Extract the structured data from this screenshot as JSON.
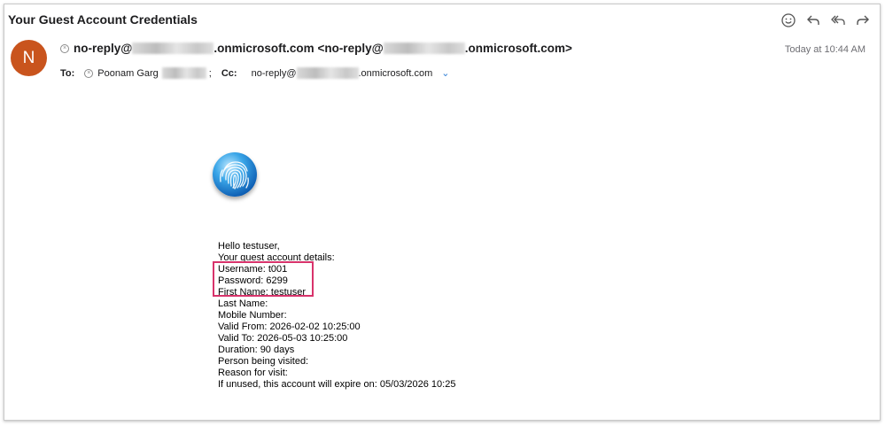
{
  "email": {
    "subject": "Your Guest Account Credentials",
    "avatar_initial": "N",
    "avatar_color": "#c9541d",
    "from_prefix": "no-reply@",
    "from_domain": ".onmicrosoft.com",
    "from_open": " <no-reply@",
    "from_close": ".onmicrosoft.com>",
    "date": "Today at 10:44 AM",
    "to_label": "To:",
    "to_name": "Poonam Garg",
    "to_sep": ";",
    "cc_label": "Cc:",
    "cc_prefix": "no-reply@",
    "cc_domain": ".onmicrosoft.com"
  },
  "toolbar": {
    "icons": [
      "smiley-icon",
      "reply-icon",
      "reply-all-icon",
      "forward-icon"
    ]
  },
  "body_lines": [
    "Hello testuser,",
    "Your guest account details:",
    "Username: t001",
    "Password: 6299",
    "First Name: testuser",
    "Last Name:",
    "Mobile Number:",
    "Valid From: 2026-02-02 10:25:00",
    "Valid To: 2026-05-03 10:25:00",
    "Duration: 90 days",
    "Person being visited:",
    "Reason for visit:",
    "If unused, this account will expire on: 05/03/2026 10:25"
  ],
  "highlight_color": "#d8336b"
}
